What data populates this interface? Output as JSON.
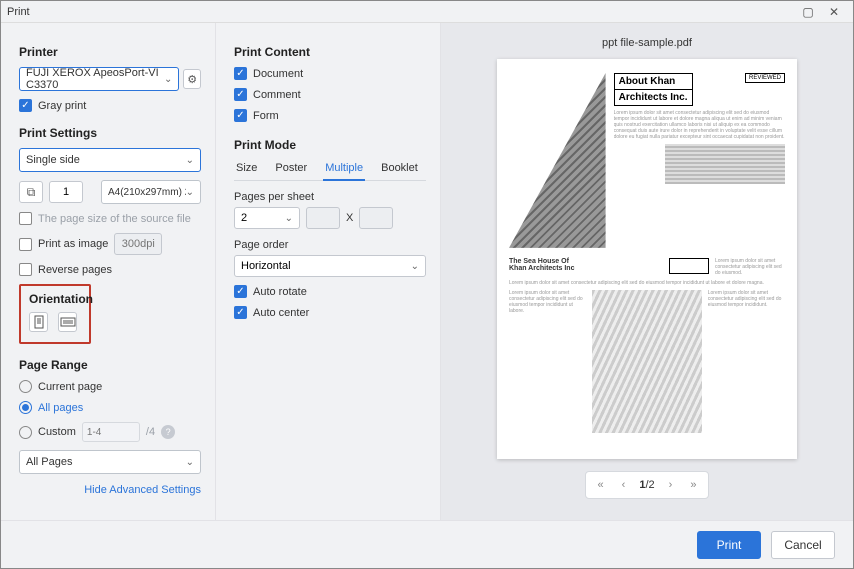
{
  "window": {
    "title": "Print"
  },
  "col1": {
    "printer_label": "Printer",
    "printer_value": "FUJI XEROX ApeosPort-VI C3370",
    "gray_print": "Gray print",
    "settings_label": "Print Settings",
    "duplex": "Single side",
    "copies": "1",
    "paper": "A4(210x297mm) 21!",
    "source_file": "The page size of the source file",
    "print_as_image": "Print as image",
    "dpi_placeholder": "300dpi",
    "reverse_pages": "Reverse pages",
    "orientation_label": "Orientation",
    "range_label": "Page Range",
    "current_page": "Current page",
    "all_pages": "All pages",
    "custom": "Custom",
    "custom_placeholder": "1-4",
    "custom_total": "/4",
    "subset": "All Pages",
    "hide_advanced": "Hide Advanced Settings"
  },
  "col2": {
    "content_label": "Print Content",
    "document": "Document",
    "comment": "Comment",
    "form": "Form",
    "mode_label": "Print Mode",
    "tabs": {
      "size": "Size",
      "poster": "Poster",
      "multiple": "Multiple",
      "booklet": "Booklet"
    },
    "pps_label": "Pages per sheet",
    "pps_value": "2",
    "x": "X",
    "order_label": "Page order",
    "order_value": "Horizontal",
    "auto_rotate": "Auto rotate",
    "auto_center": "Auto center"
  },
  "preview": {
    "filename": "ppt file-sample.pdf",
    "h1a": "About Khan",
    "h1b": "Architects Inc.",
    "h2a": "The Sea House Of",
    "h2b": "Khan Architects Inc",
    "badge": "REVIEWED",
    "pager": {
      "current": "1",
      "total": "/2"
    }
  },
  "footer": {
    "print": "Print",
    "cancel": "Cancel"
  }
}
